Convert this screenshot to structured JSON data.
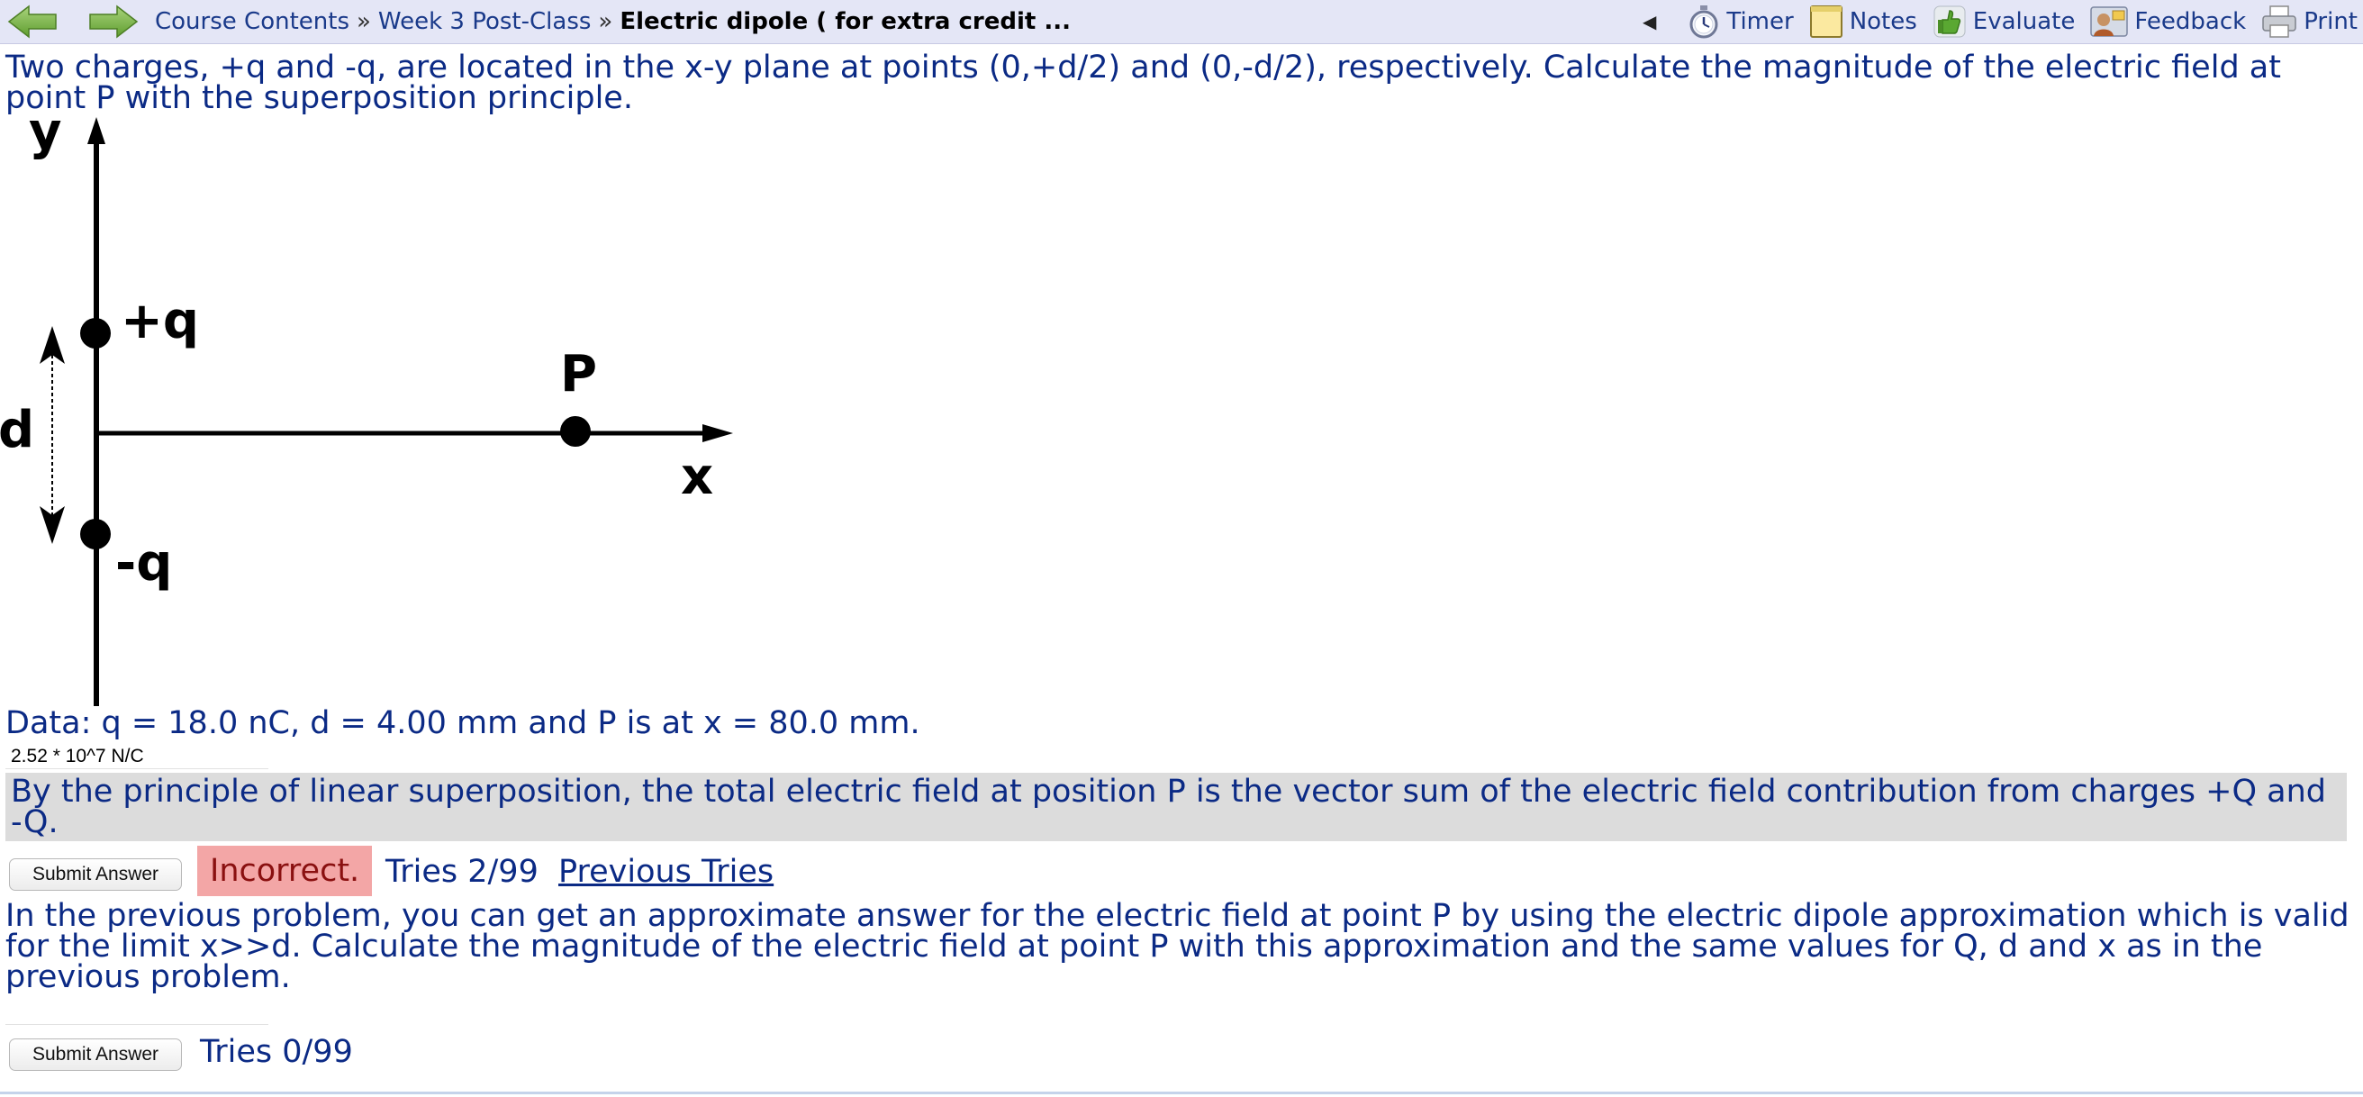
{
  "nav": {
    "crumbs": [
      "Course Contents",
      "Week 3 Post-Class"
    ],
    "separator": "»",
    "current": "Electric dipole ( for extra credit ...",
    "collapse_glyph": "◀",
    "tools": {
      "timer": "Timer",
      "notes": "Notes",
      "evaluate": "Evaluate",
      "feedback": "Feedback",
      "print": "Print"
    }
  },
  "problem1": {
    "text": "Two charges, +q and -q, are located in the x-y plane at points (0,+d/2) and (0,-d/2), respectively. Calculate the magnitude of the electric field at point P with the superposition principle.",
    "diagram": {
      "y_label": "y",
      "x_label": "x",
      "pos_charge_label": "+q",
      "neg_charge_label": "-q",
      "d_label": "d",
      "point_label": "P"
    },
    "data": "Data: q = 18.0 nC, d = 4.00 mm and P is at x = 80.0 mm.",
    "answer_value": "2.52 * 10^7 N/C",
    "hint": "By the principle of linear superposition, the total electric field at position P is the vector sum of the electric field contribution from charges +Q and -Q.",
    "submit_label": "Submit Answer",
    "status": "Incorrect.",
    "tries": "Tries 2/99",
    "previous_tries": "Previous Tries"
  },
  "problem2": {
    "text": "In the previous problem, you can get an approximate answer for the electric field at point P by using the electric dipole approximation which is valid for the limit x>>d. Calculate the magnitude of the electric field at point P with this approximation and the same values for Q, d and x as in the previous problem.",
    "answer_value": "",
    "submit_label": "Submit Answer",
    "tries": "Tries 0/99"
  },
  "colors": {
    "text_blue": "#0b2a85",
    "topbar_bg": "#e4e6f6",
    "incorrect_bg": "#f3a6a6",
    "hint_bg": "#dcdcdc",
    "nav_arrow_green": "#7ab648"
  }
}
